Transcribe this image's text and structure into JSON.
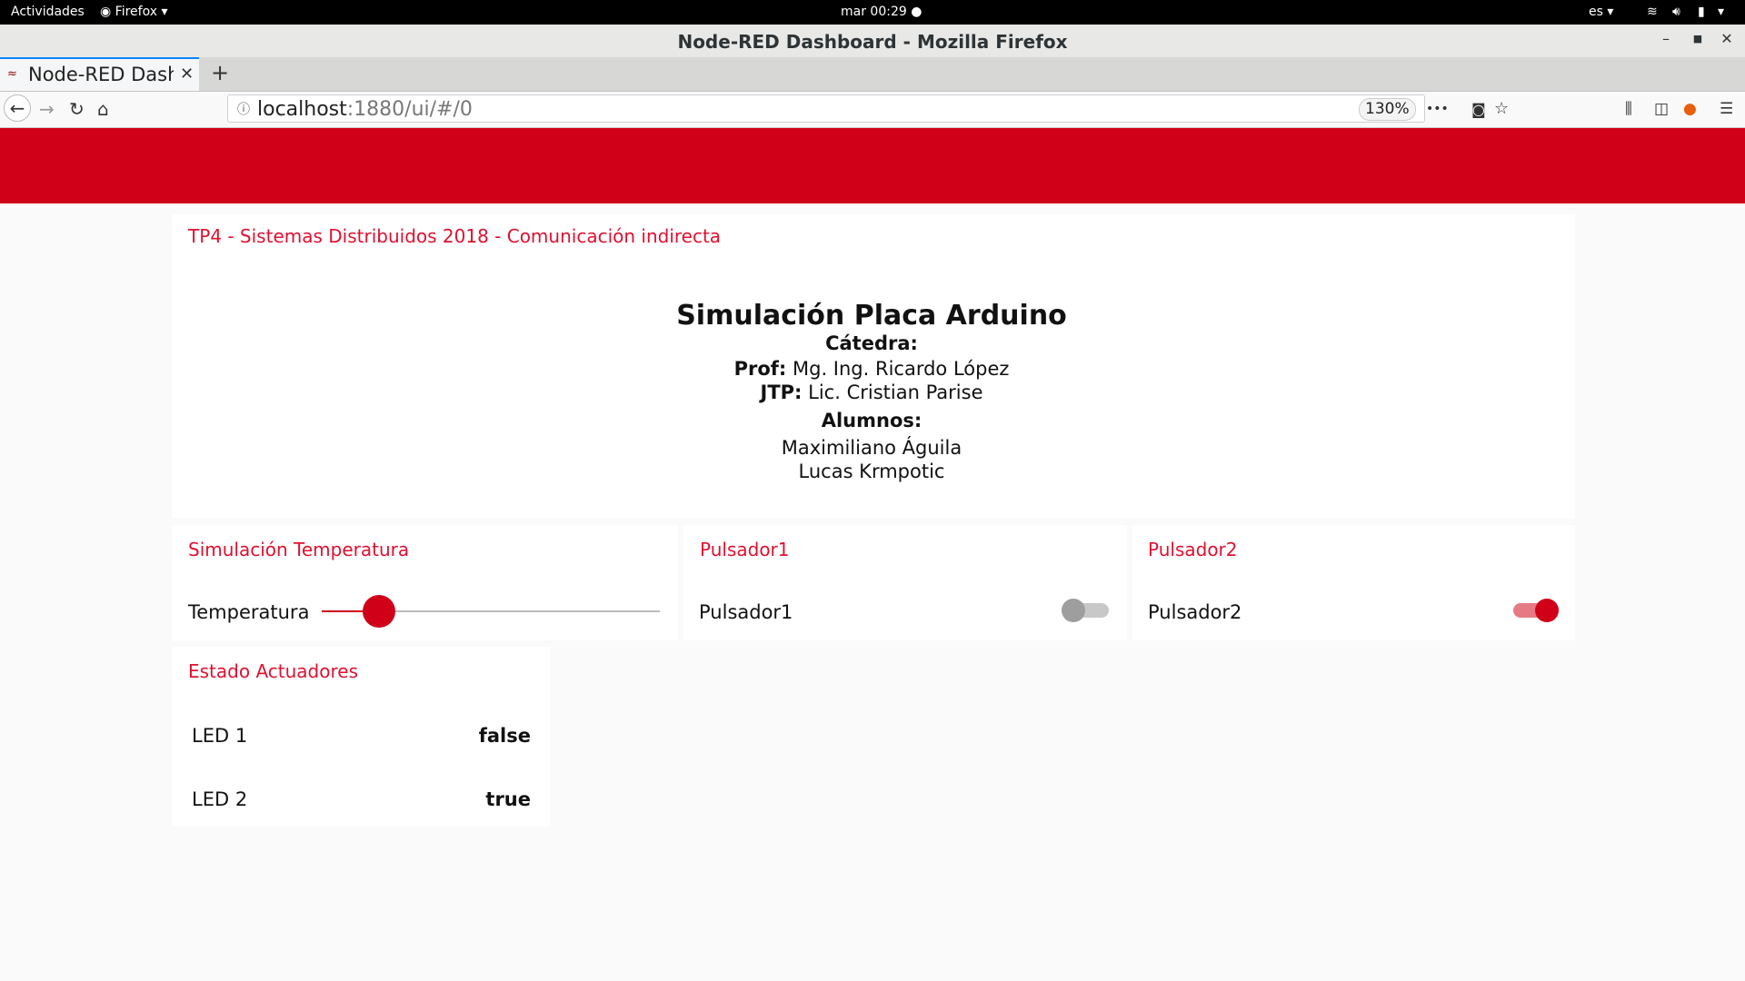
{
  "system_bar": {
    "activities": "Actividades",
    "app_menu": "Firefox",
    "clock": "mar 00:29",
    "language": "es"
  },
  "window": {
    "title": "Node-RED Dashboard - Mozilla Firefox"
  },
  "tab": {
    "title": "Node-RED Dashboard"
  },
  "address_bar": {
    "host": "localhost",
    "path": ":1880/ui/#/0",
    "zoom": "130%"
  },
  "dashboard": {
    "info_card": {
      "title": "TP4 - Sistemas Distribuidos 2018 - Comunicación indirecta",
      "heading": "Simulación Placa Arduino",
      "catedra_label": "Cátedra:",
      "prof_label": "Prof:",
      "prof_name": "Mg. Ing. Ricardo López",
      "jtp_label": "JTP:",
      "jtp_name": "Lic. Cristian Parise",
      "alumnos_label": "Alumnos:",
      "alumno_1": "Maximiliano Águila",
      "alumno_2": "Lucas Krmpotic"
    },
    "temperature_card": {
      "title": "Simulación Temperatura",
      "slider_label": "Temperatura",
      "slider_fraction": 0.12
    },
    "pulsador1_card": {
      "title": "Pulsador1",
      "switch_label": "Pulsador1",
      "switch_on": false
    },
    "pulsador2_card": {
      "title": "Pulsador2",
      "switch_label": "Pulsador2",
      "switch_on": true
    },
    "estado_card": {
      "title": "Estado Actuadores",
      "rows": [
        {
          "label": "LED 1",
          "value": "false"
        },
        {
          "label": "LED 2",
          "value": "true"
        }
      ]
    }
  },
  "colors": {
    "accent": "#d00018",
    "title_text": "#e01030",
    "switch_off_track": "#c8c8c8",
    "switch_off_knob": "#9e9e9e",
    "switch_on_track": "#e57a85"
  }
}
